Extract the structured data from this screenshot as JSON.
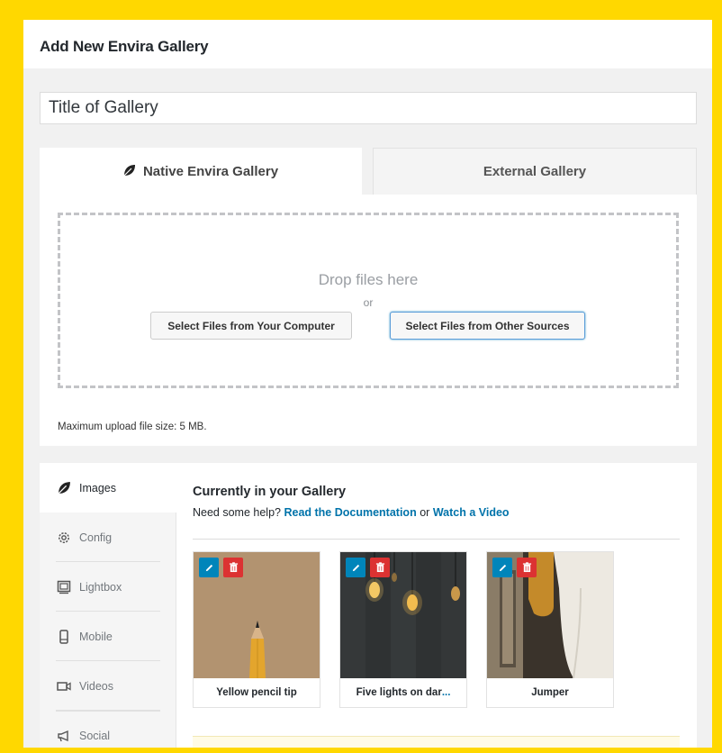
{
  "page": {
    "title": "Add New Envira Gallery"
  },
  "gallery_title": {
    "value": "Title of Gallery"
  },
  "tabs": [
    {
      "label": "Native Envira Gallery",
      "active": true,
      "icon": "leaf-icon"
    },
    {
      "label": "External Gallery",
      "active": false
    }
  ],
  "upload": {
    "drop_text": "Drop files here",
    "or_text": "or",
    "select_computer_label": "Select Files from Your Computer",
    "select_other_label": "Select Files from Other Sources",
    "max_size_text": "Maximum upload file size: 5 MB."
  },
  "side_tabs": [
    {
      "label": "Images",
      "icon": "leaf-icon",
      "active": true
    },
    {
      "label": "Config",
      "icon": "gear-icon",
      "active": false
    },
    {
      "label": "Lightbox",
      "icon": "lightbox-icon",
      "active": false
    },
    {
      "label": "Mobile",
      "icon": "mobile-icon",
      "active": false
    },
    {
      "label": "Videos",
      "icon": "video-icon",
      "active": false
    },
    {
      "label": "Social",
      "icon": "megaphone-icon",
      "active": false
    }
  ],
  "gallery": {
    "heading": "Currently in your Gallery",
    "help_prefix": "Need some help?",
    "help_doc_link": "Read the Documentation",
    "help_or": "or",
    "help_video_link": "Watch a Video",
    "items": [
      {
        "caption": "Yellow pencil tip",
        "caption_truncated": false
      },
      {
        "caption": "Five lights on dar",
        "caption_truncated": true,
        "ellipsis": "..."
      },
      {
        "caption": "Jumper",
        "caption_truncated": false
      }
    ]
  },
  "colors": {
    "frame_border": "#ffd800",
    "link": "#0073aa",
    "edit_button": "#0085ba",
    "delete_button": "#dc3232"
  }
}
